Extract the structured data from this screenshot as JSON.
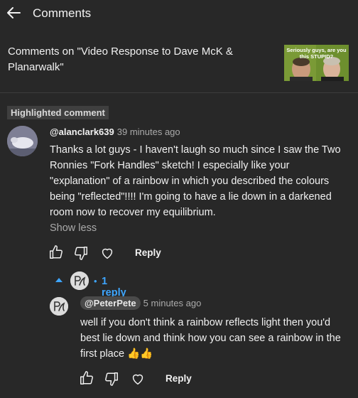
{
  "header": {
    "title": "Comments"
  },
  "video": {
    "title": "Comments on \"Video Response to Dave McK & Planarwalk\"",
    "thumbnail_text": "Seriously guys, are you this STUPID?"
  },
  "highlighted_label": "Highlighted comment",
  "comment": {
    "author": "@alanclark639",
    "time": "39 minutes ago",
    "text": "Thanks a lot guys - I haven't laugh so much since I saw the Two Ronnies \"Fork Handles\" sketch!  I especially like your \"explanation\" of a rainbow in which you described the colours being \"reflected\"!!!! I'm going to have a lie down in a darkened room now to recover my equilibrium.",
    "show_less": "Show less",
    "reply_label": "Reply"
  },
  "replies": {
    "dot": "•",
    "count_label": "1 reply"
  },
  "reply": {
    "mention": "@PeterPete",
    "time": "5 minutes ago",
    "text": "well if you don't think a rainbow reflects light then you'd best lie down and think how you can see a rainbow in the first place",
    "emoji": "👍👍",
    "reply_label": "Reply"
  },
  "colors": {
    "background": "#282828",
    "link": "#3ea6ff",
    "secondary_text": "#aaaaaa"
  },
  "icons": [
    "back-arrow-icon",
    "like-icon",
    "dislike-icon",
    "heart-icon",
    "caret-up-icon"
  ]
}
